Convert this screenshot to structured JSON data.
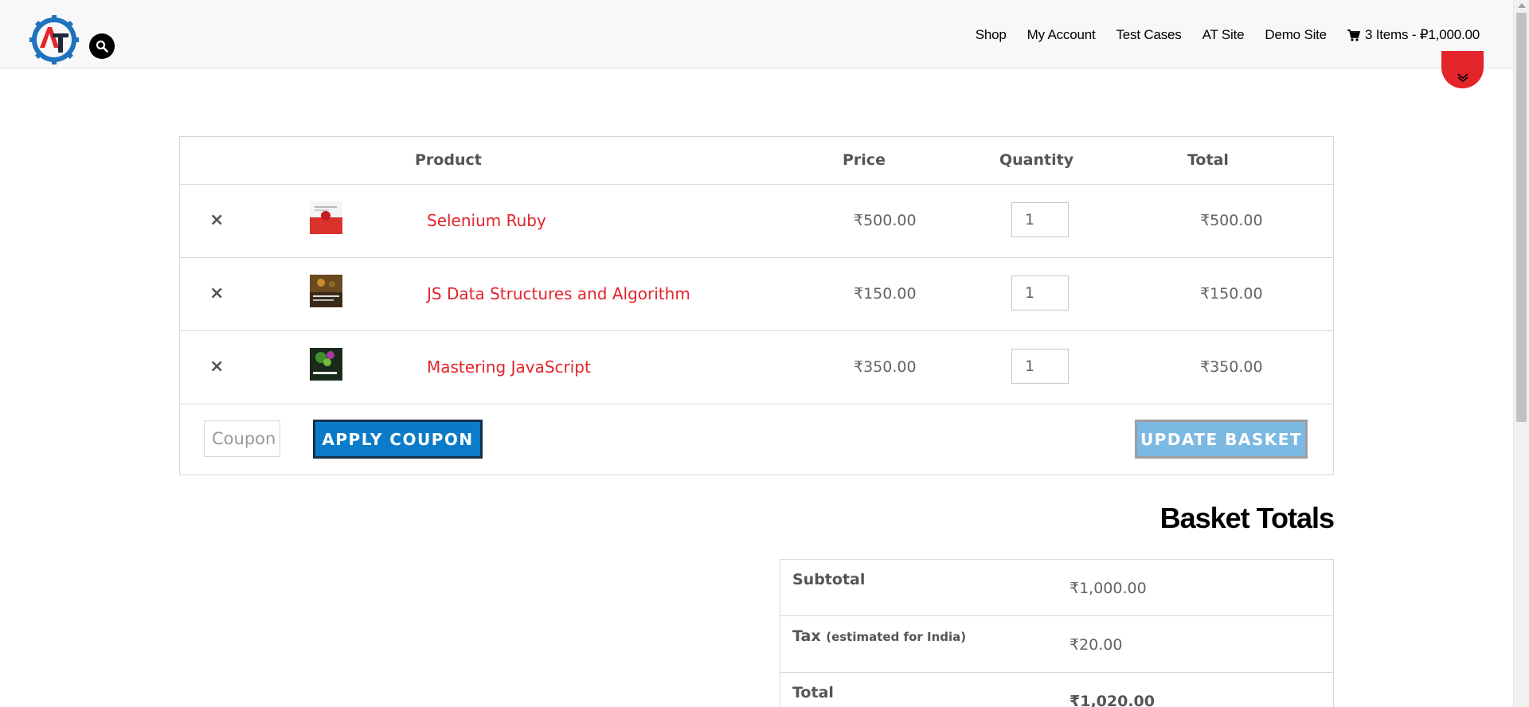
{
  "header": {
    "nav": [
      {
        "label": "Shop"
      },
      {
        "label": "My Account"
      },
      {
        "label": "Test Cases"
      },
      {
        "label": "AT Site"
      },
      {
        "label": "Demo Site"
      }
    ],
    "cart_summary": "3 Items - ₽1,000.00"
  },
  "cart": {
    "headers": {
      "product": "Product",
      "price": "Price",
      "quantity": "Quantity",
      "total": "Total"
    },
    "items": [
      {
        "name": "Selenium Ruby",
        "price": "₹500.00",
        "qty": "1",
        "total": "₹500.00"
      },
      {
        "name": "JS Data Structures and Algorithm",
        "price": "₹150.00",
        "qty": "1",
        "total": "₹150.00"
      },
      {
        "name": "Mastering JavaScript",
        "price": "₹350.00",
        "qty": "1",
        "total": "₹350.00"
      }
    ],
    "remove_glyph": "×",
    "coupon_placeholder": "Coupon code",
    "apply_label": "APPLY COUPON",
    "update_label": "UPDATE BASKET"
  },
  "totals": {
    "title": "Basket Totals",
    "subtotal_label": "Subtotal",
    "subtotal": "₹1,000.00",
    "tax_label": "Tax",
    "tax_note": "(estimated for India)",
    "tax": "₹20.00",
    "total_label": "Total",
    "total": "₹1,020.00"
  },
  "colors": {
    "accent_red": "#e3242b",
    "button_blue": "#0a7bc8",
    "button_disabled": "#7bb9e2"
  },
  "icons": [
    "logo",
    "search-icon",
    "cart-icon",
    "scroll-top-icon",
    "remove-icon"
  ]
}
